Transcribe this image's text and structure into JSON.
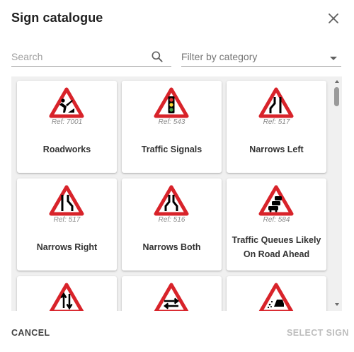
{
  "dialog": {
    "title": "Sign catalogue",
    "close_icon": "close-icon"
  },
  "search": {
    "placeholder": "Search",
    "value": "",
    "icon": "search-icon"
  },
  "filter": {
    "label": "Filter by category",
    "icon": "chevron-down-icon"
  },
  "signs": [
    {
      "name": "Roadworks",
      "ref": "Ref: 7001",
      "icon": "roadworks-sign-icon"
    },
    {
      "name": "Traffic Signals",
      "ref": "Ref: 543",
      "icon": "traffic-signals-sign-icon"
    },
    {
      "name": "Narrows Left",
      "ref": "Ref: 517",
      "icon": "road-narrows-left-sign-icon"
    },
    {
      "name": "Narrows Right",
      "ref": "Ref: 517",
      "icon": "road-narrows-right-sign-icon"
    },
    {
      "name": "Narrows Both",
      "ref": "Ref: 516",
      "icon": "road-narrows-both-sign-icon"
    },
    {
      "name": "Traffic Queues Likely On Road Ahead",
      "ref": "Ref: 584",
      "icon": "traffic-queues-sign-icon"
    },
    {
      "name": "",
      "ref": "",
      "icon": "two-way-traffic-sign-icon"
    },
    {
      "name": "",
      "ref": "",
      "icon": "two-way-traffic-crosses-sign-icon"
    },
    {
      "name": "",
      "ref": "",
      "icon": "loose-chippings-sign-icon"
    }
  ],
  "footer": {
    "cancel_label": "CANCEL",
    "select_label": "SELECT SIGN"
  },
  "colors": {
    "sign_red": "#d8232a",
    "disabled_text": "#bdbdbd"
  }
}
